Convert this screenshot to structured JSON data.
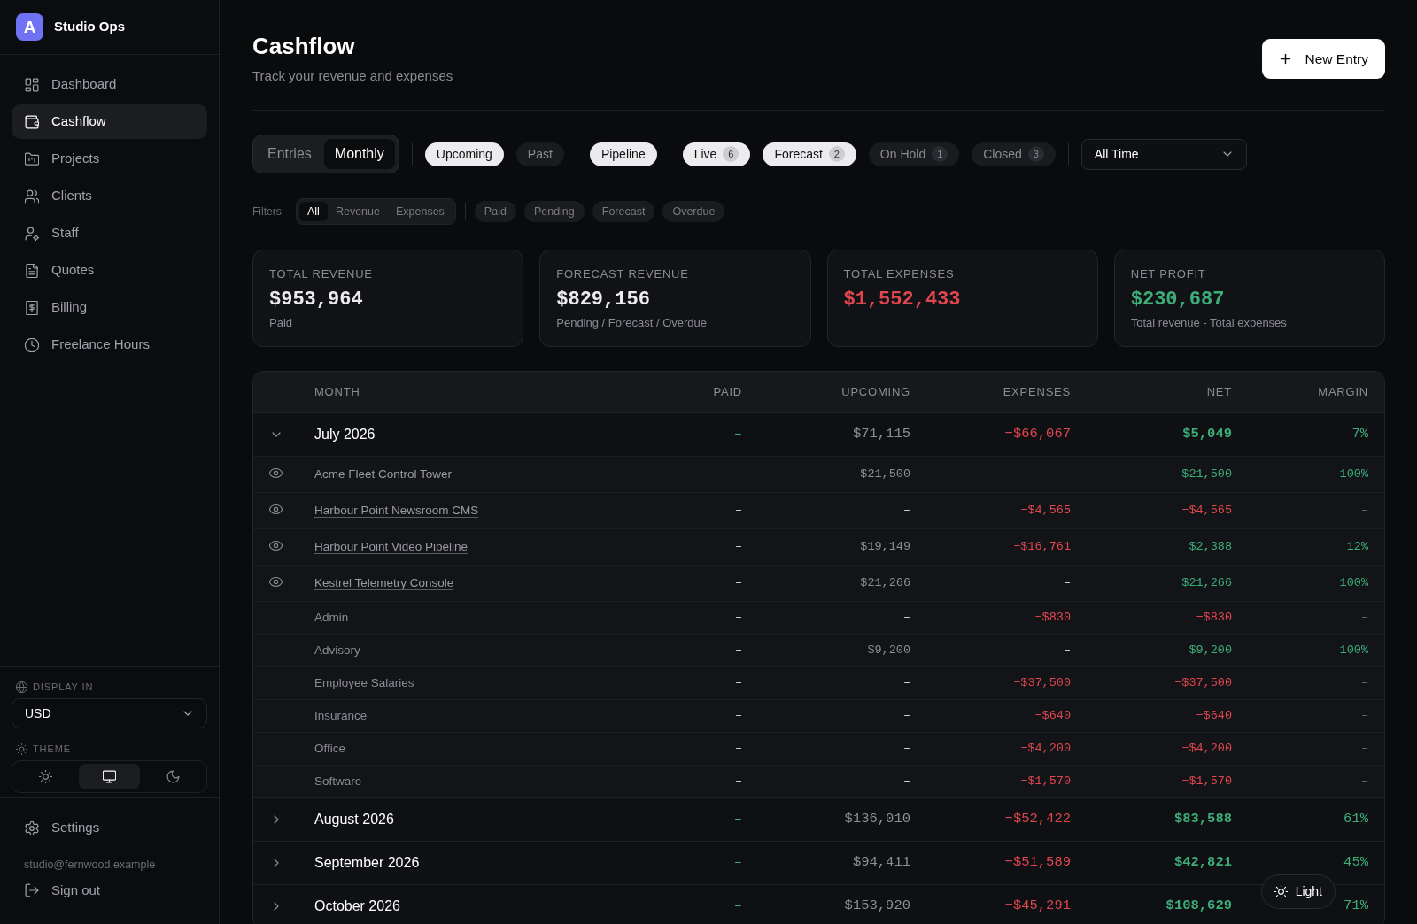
{
  "app": {
    "logo": "A",
    "name": "Studio Ops"
  },
  "sidebar": {
    "items": [
      {
        "label": "Dashboard",
        "selected": false
      },
      {
        "label": "Cashflow",
        "selected": true
      },
      {
        "label": "Projects",
        "selected": false
      },
      {
        "label": "Clients",
        "selected": false
      },
      {
        "label": "Staff",
        "selected": false
      },
      {
        "label": "Quotes",
        "selected": false
      },
      {
        "label": "Billing",
        "selected": false
      },
      {
        "label": "Freelance Hours",
        "selected": false
      }
    ],
    "display_in": {
      "label": "DISPLAY IN",
      "value": "USD"
    },
    "theme": {
      "label": "THEME",
      "options": [
        {
          "selected": false
        },
        {
          "selected": true
        },
        {
          "selected": false
        }
      ]
    },
    "settings": "Settings",
    "account_email": "studio@fernwood.example",
    "sign_out": "Sign out"
  },
  "header": {
    "title": "Cashflow",
    "subtitle": "Track your revenue and expenses",
    "new_entry_button": "New Entry"
  },
  "toolbar": {
    "view_tabs": [
      {
        "label": "Entries",
        "selected": false
      },
      {
        "label": "Monthly",
        "selected": true
      }
    ],
    "pill_groups": [
      {
        "items": [
          {
            "label": "Upcoming",
            "selected": true
          },
          {
            "label": "Past",
            "selected": false
          }
        ]
      },
      {
        "items": [
          {
            "label": "Pipeline",
            "selected": true
          }
        ]
      },
      {
        "items": [
          {
            "label": "Live",
            "count": "6",
            "selected": true
          },
          {
            "label": "Forecast",
            "count": "2",
            "selected": true
          },
          {
            "label": "On Hold",
            "count": "1",
            "selected": false
          },
          {
            "label": "Closed",
            "count": "3",
            "selected": false
          }
        ]
      }
    ],
    "period": "All Time"
  },
  "filters": {
    "label": "Filters:",
    "type_tabs": [
      {
        "label": "All",
        "selected": true
      },
      {
        "label": "Revenue",
        "selected": false
      },
      {
        "label": "Expenses",
        "selected": false
      }
    ],
    "status_pills": [
      {
        "label": "Paid",
        "selected": false
      },
      {
        "label": "Pending",
        "selected": false
      },
      {
        "label": "Forecast",
        "selected": false
      },
      {
        "label": "Overdue",
        "selected": false
      }
    ]
  },
  "summary_cards": [
    {
      "label": "TOTAL REVENUE",
      "value": "$953,964",
      "color": "#ececef",
      "note": "Paid"
    },
    {
      "label": "FORECAST REVENUE",
      "value": "$829,156",
      "color": "#ececef",
      "note": "Pending / Forecast / Overdue"
    },
    {
      "label": "TOTAL EXPENSES",
      "value": "$1,552,433",
      "color": "#e0464e"
    },
    {
      "label": "NET PROFIT",
      "value": "$230,687",
      "color": "#3dae78",
      "note": "Total revenue - Total expenses"
    }
  ],
  "table": {
    "columns": [
      "MONTH",
      "PAID",
      "UPCOMING",
      "EXPENSES",
      "NET",
      "MARGIN"
    ],
    "rows": [
      {
        "kind": "month",
        "expanded": true,
        "cells": [
          {
            "text": "July 2026"
          },
          {
            "text": "–",
            "color": "#3dae78"
          },
          {
            "text": "$71,115",
            "color": "#8e8e96"
          },
          {
            "text": "−$66,067",
            "color": "#e0464e"
          },
          {
            "text": "$5,049",
            "color": "#3dae78"
          },
          {
            "text": "7%",
            "color": "#3dae78"
          }
        ],
        "children": [
          {
            "kind": "project",
            "cells": [
              {
                "text": "Acme Fleet Control Tower"
              },
              {
                "text": "–"
              },
              {
                "text": "$21,500",
                "color": "#8e8e96"
              },
              {
                "text": "–"
              },
              {
                "text": "$21,500",
                "color": "#3dae78"
              },
              {
                "text": "100%",
                "color": "#3dae78"
              }
            ]
          },
          {
            "kind": "project",
            "cells": [
              {
                "text": "Harbour Point Newsroom CMS"
              },
              {
                "text": "–"
              },
              {
                "text": "–"
              },
              {
                "text": "−$4,565",
                "color": "#e0464e"
              },
              {
                "text": "−$4,565",
                "color": "#e0464e"
              },
              {
                "text": "–"
              }
            ]
          },
          {
            "kind": "project",
            "cells": [
              {
                "text": "Harbour Point Video Pipeline"
              },
              {
                "text": "–"
              },
              {
                "text": "$19,149",
                "color": "#8e8e96"
              },
              {
                "text": "−$16,761",
                "color": "#e0464e"
              },
              {
                "text": "$2,388",
                "color": "#3dae78"
              },
              {
                "text": "12%",
                "color": "#3dae78"
              }
            ]
          },
          {
            "kind": "project",
            "cells": [
              {
                "text": "Kestrel Telemetry Console"
              },
              {
                "text": "–"
              },
              {
                "text": "$21,266",
                "color": "#8e8e96"
              },
              {
                "text": "–"
              },
              {
                "text": "$21,266",
                "color": "#3dae78"
              },
              {
                "text": "100%",
                "color": "#3dae78"
              }
            ]
          },
          {
            "kind": "category",
            "cells": [
              {
                "text": "Admin"
              },
              {
                "text": "–"
              },
              {
                "text": "–"
              },
              {
                "text": "−$830",
                "color": "#e0464e"
              },
              {
                "text": "−$830",
                "color": "#e0464e"
              },
              {
                "text": "–"
              }
            ]
          },
          {
            "kind": "category",
            "cells": [
              {
                "text": "Advisory"
              },
              {
                "text": "–"
              },
              {
                "text": "$9,200",
                "color": "#8e8e96"
              },
              {
                "text": "–"
              },
              {
                "text": "$9,200",
                "color": "#3dae78"
              },
              {
                "text": "100%",
                "color": "#3dae78"
              }
            ]
          },
          {
            "kind": "category",
            "cells": [
              {
                "text": "Employee Salaries"
              },
              {
                "text": "–"
              },
              {
                "text": "–"
              },
              {
                "text": "−$37,500",
                "color": "#e0464e"
              },
              {
                "text": "−$37,500",
                "color": "#e0464e"
              },
              {
                "text": "–"
              }
            ]
          },
          {
            "kind": "category",
            "cells": [
              {
                "text": "Insurance"
              },
              {
                "text": "–"
              },
              {
                "text": "–"
              },
              {
                "text": "−$640",
                "color": "#e0464e"
              },
              {
                "text": "−$640",
                "color": "#e0464e"
              },
              {
                "text": "–"
              }
            ]
          },
          {
            "kind": "category",
            "cells": [
              {
                "text": "Office"
              },
              {
                "text": "–"
              },
              {
                "text": "–"
              },
              {
                "text": "−$4,200",
                "color": "#e0464e"
              },
              {
                "text": "−$4,200",
                "color": "#e0464e"
              },
              {
                "text": "–"
              }
            ]
          },
          {
            "kind": "category",
            "cells": [
              {
                "text": "Software"
              },
              {
                "text": "–"
              },
              {
                "text": "–"
              },
              {
                "text": "−$1,570",
                "color": "#e0464e"
              },
              {
                "text": "−$1,570",
                "color": "#e0464e"
              },
              {
                "text": "–"
              }
            ]
          }
        ]
      },
      {
        "kind": "month",
        "expanded": false,
        "cells": [
          {
            "text": "August 2026"
          },
          {
            "text": "–",
            "color": "#3dae78"
          },
          {
            "text": "$136,010",
            "color": "#8e8e96"
          },
          {
            "text": "−$52,422",
            "color": "#e0464e"
          },
          {
            "text": "$83,588",
            "color": "#3dae78"
          },
          {
            "text": "61%",
            "color": "#3dae78"
          }
        ]
      },
      {
        "kind": "month",
        "expanded": false,
        "cells": [
          {
            "text": "September 2026"
          },
          {
            "text": "–",
            "color": "#3dae78"
          },
          {
            "text": "$94,411",
            "color": "#8e8e96"
          },
          {
            "text": "−$51,589",
            "color": "#e0464e"
          },
          {
            "text": "$42,821",
            "color": "#3dae78"
          },
          {
            "text": "45%",
            "color": "#3dae78"
          }
        ]
      },
      {
        "kind": "month",
        "expanded": false,
        "cells": [
          {
            "text": "October 2026"
          },
          {
            "text": "–",
            "color": "#3dae78"
          },
          {
            "text": "$153,920",
            "color": "#8e8e96"
          },
          {
            "text": "−$45,291",
            "color": "#e0464e"
          },
          {
            "text": "$108,629",
            "color": "#3dae78"
          },
          {
            "text": "71%",
            "color": "#3dae78"
          }
        ]
      }
    ]
  },
  "theme_toggle": {
    "label": "Light"
  }
}
